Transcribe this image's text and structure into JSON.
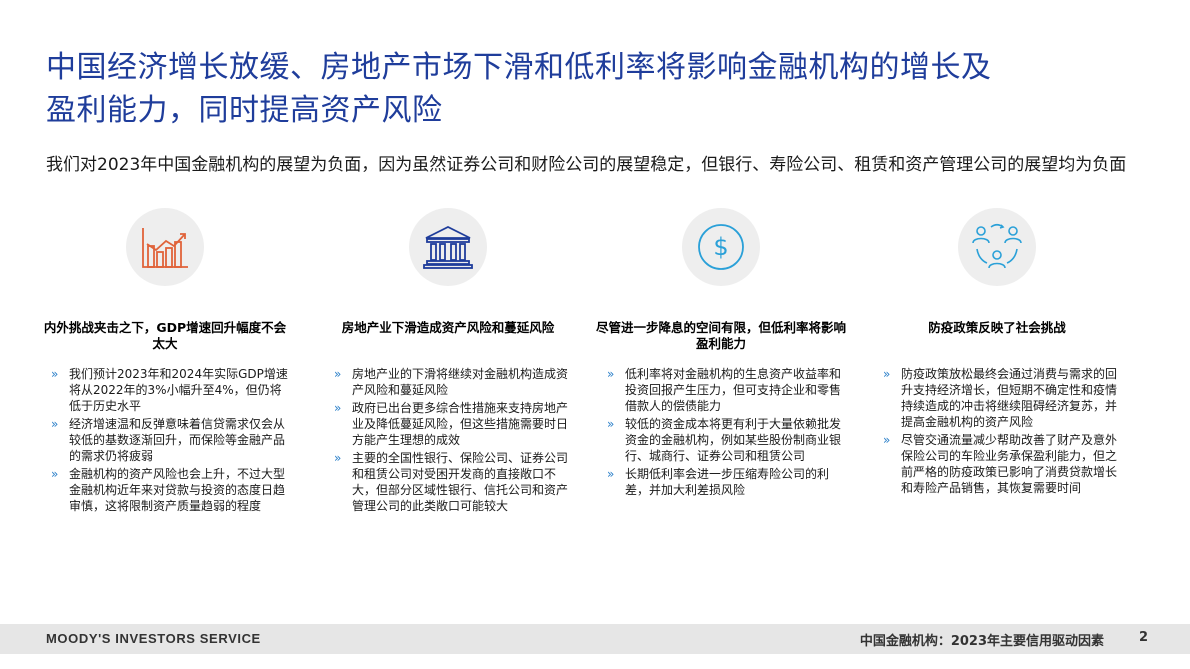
{
  "header": {
    "title_line1": "中国经济增长放缓、房地产市场下滑和低利率将影响金融机构的增长及",
    "title_line2": "盈利能力，同时提高资产风险",
    "subtitle": "我们对2023年中国金融机构的展望为负面，因为虽然证券公司和财险公司的展望稳定，但银行、寿险公司、租赁和资产管理公司的展望均为负面"
  },
  "columns": [
    {
      "icon": "bar-chart-growth-icon",
      "icon_color": "#e0633a",
      "title": "内外挑战夹击之下，GDP增速回升幅度不会太大",
      "bullets": [
        "我们预计2023年和2024年实际GDP增速将从2022年的3%小幅升至4%，但仍将低于历史水平",
        "经济增速温和反弹意味着信贷需求仅会从较低的基数逐渐回升，而保险等金融产品的需求仍将疲弱",
        "金融机构的资产风险也会上升，不过大型金融机构近年来对贷款与投资的态度日趋审慎，这将限制资产质量趋弱的程度"
      ]
    },
    {
      "icon": "bank-building-icon",
      "icon_color": "#1f3d9b",
      "title": "房地产业下滑造成资产风险和蔓延风险",
      "bullets": [
        "房地产业的下滑将继续对金融机构造成资产风险和蔓延风险",
        "政府已出台更多综合性措施来支持房地产业及降低蔓延风险，但这些措施需要时日方能产生理想的成效",
        "主要的全国性银行、保险公司、证券公司和租赁公司对受困开发商的直接敞口不大，但部分区域性银行、信托公司和资产管理公司的此类敞口可能较大"
      ]
    },
    {
      "icon": "dollar-coin-icon",
      "icon_color": "#2aa0d8",
      "title": "尽管进一步降息的空间有限，但低利率将影响盈利能力",
      "bullets": [
        "低利率将对金融机构的生息资产收益率和投资回报产生压力，但可支持企业和零售借款人的偿债能力",
        "较低的资金成本将更有利于大量依赖批发资金的金融机构，例如某些股份制商业银行、城商行、证券公司和租赁公司",
        "长期低利率会进一步压缩寿险公司的利差，并加大利差损风险"
      ]
    },
    {
      "icon": "people-cycle-icon",
      "icon_color": "#2aa0d8",
      "title": "防疫政策反映了社会挑战",
      "bullets": [
        "防疫政策放松最终会通过消费与需求的回升支持经济增长，但短期不确定性和疫情持续造成的冲击将继续阻碍经济复苏，并提高金融机构的资产风险",
        "尽管交通流量减少帮助改善了财产及意外保险公司的车险业务承保盈利能力，但之前严格的防疫政策已影响了消费贷款增长和寿险产品销售，其恢复需要时间"
      ]
    }
  ],
  "bullet_mark": "»",
  "footer": {
    "brand": "MOODY'S INVESTORS SERVICE",
    "doc_title": "中国金融机构：2023年主要信用驱动因素",
    "page_number": "2"
  }
}
